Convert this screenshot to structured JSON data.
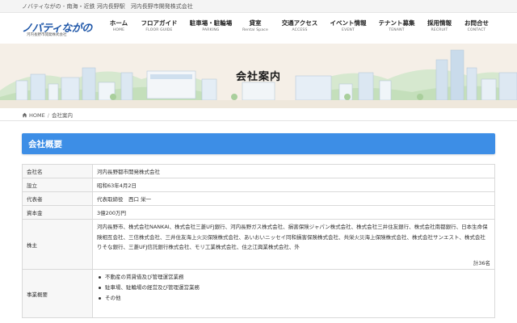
{
  "topbar": {
    "text": "ノバティながの - 南海・近鉄 河内長野駅　河内長野市開発株式会社"
  },
  "logo": {
    "main": "ノバティながの",
    "sub": "河内長野市開発株式会社"
  },
  "nav": [
    {
      "jp": "ホーム",
      "en": "HOME"
    },
    {
      "jp": "フロアガイド",
      "en": "FLOOR GUIDE"
    },
    {
      "jp": "駐車場・駐輪場",
      "en": "PARKING"
    },
    {
      "jp": "貸室",
      "en": "Rental Space"
    },
    {
      "jp": "交通アクセス",
      "en": "ACCESS"
    },
    {
      "jp": "イベント情報",
      "en": "EVENT"
    },
    {
      "jp": "テナント募集",
      "en": "TENANT"
    },
    {
      "jp": "採用情報",
      "en": "RECRUIT"
    },
    {
      "jp": "お問合せ",
      "en": "CONTACT"
    }
  ],
  "hero": {
    "title": "会社案内"
  },
  "breadcrumb": {
    "home": "HOME",
    "separator": "/",
    "current": "会社案内"
  },
  "section": {
    "title": "会社概要"
  },
  "table": {
    "company_label": "会社名",
    "company_value": "河内長野都市開発株式会社",
    "founded_label": "設立",
    "founded_value": "昭和63年4月2日",
    "rep_label": "代表者",
    "rep_value": "代表取締役　西口 栄一",
    "capital_label": "資本金",
    "capital_value": "3億200万円",
    "shareholders_label": "株主",
    "shareholders_value": "河内長野市、株式会社NANKAI、株式会社三菱UFJ銀行、河内長野ガス株式会社、損害保険ジャパン株式会社、株式会社三井住友銀行、株式会社南都銀行、日本生命保険相互会社、三信株式会社、三井住友海上火災保険株式会社、あいおいニッセイ同和損害保険株式会社、共栄火災海上保険株式会社、株式会社サンエスト、株式会社りそな銀行、三菱UFJ信託銀行株式会社、モリ工業株式会社、住之江興業株式会社、外",
    "shareholders_total": "計36名",
    "business_label": "事業概要",
    "business_items": [
      "不動産の賃貸借及び管理運営業務",
      "駐車場、駐輪場の経営及び管理運営業務",
      "その他"
    ]
  },
  "colors": {
    "brand_blue": "#1e56a8",
    "section_blue": "#3d8ee6",
    "hero_bg": "#f5efe7"
  }
}
